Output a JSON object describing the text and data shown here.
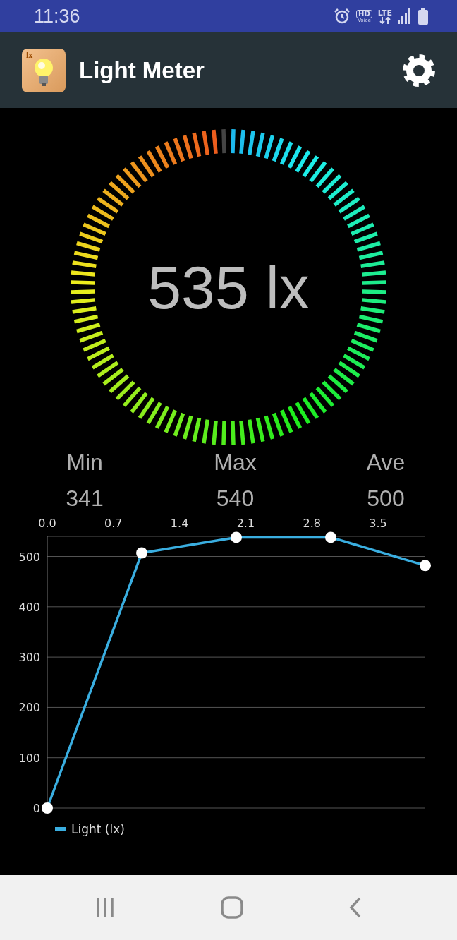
{
  "status_bar": {
    "time": "11:36",
    "hd_badge": "HD",
    "voice_label": "Voice",
    "network": "LTE"
  },
  "app_bar": {
    "icon_label": "lx",
    "title": "Light Meter"
  },
  "gauge": {
    "reading": "535 lx"
  },
  "stats": [
    {
      "label": "Min",
      "value": "341"
    },
    {
      "label": "Max",
      "value": "540"
    },
    {
      "label": "Ave",
      "value": "500"
    }
  ],
  "chart": {
    "chart_data": {
      "type": "line",
      "x": [
        0,
        1,
        2,
        3,
        4
      ],
      "series": [
        {
          "name": "Light (lx)",
          "color": "#3aaee0",
          "marker": "circle",
          "values": [
            0,
            507,
            538,
            538,
            482
          ]
        }
      ],
      "xlim": [
        0,
        4
      ],
      "ylim": [
        0,
        540
      ],
      "xticks": [
        {
          "value": 0,
          "label": "0.0"
        },
        {
          "value": 0.7,
          "label": "0.7"
        },
        {
          "value": 1.4,
          "label": "1.4"
        },
        {
          "value": 2.1,
          "label": "2.1"
        },
        {
          "value": 2.8,
          "label": "2.8"
        },
        {
          "value": 3.5,
          "label": "3.5"
        }
      ],
      "yticks": [
        0,
        100,
        200,
        300,
        400,
        500
      ],
      "grid": true
    }
  }
}
